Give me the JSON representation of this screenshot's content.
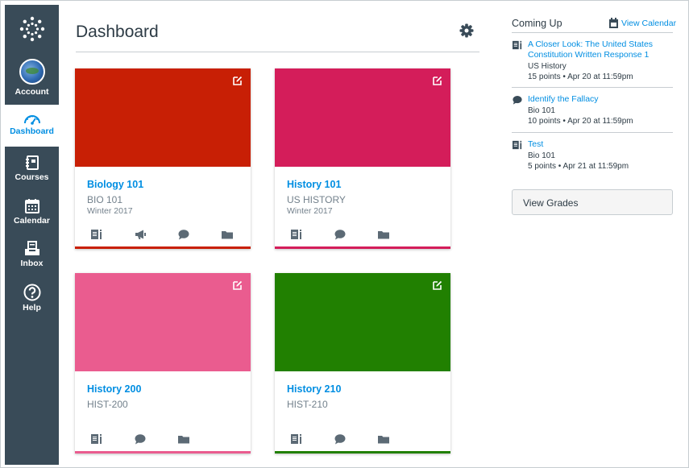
{
  "nav": {
    "account": "Account",
    "dashboard": "Dashboard",
    "courses": "Courses",
    "calendar": "Calendar",
    "inbox": "Inbox",
    "help": "Help"
  },
  "header": {
    "title": "Dashboard"
  },
  "cards": [
    {
      "name": "Biology 101",
      "code": "BIO 101",
      "term": "Winter 2017",
      "color": "#c81f05",
      "icons": [
        "assignments-icon",
        "announcements-icon",
        "discussions-icon",
        "files-icon"
      ]
    },
    {
      "name": "History 101",
      "code": "US HISTORY",
      "term": "Winter 2017",
      "color": "#d41d5a",
      "icons": [
        "assignments-icon",
        "discussions-icon",
        "files-icon"
      ]
    },
    {
      "name": "History 200",
      "code": "HIST-200",
      "term": "",
      "color": "#ea5c8f",
      "icons": [
        "assignments-icon",
        "discussions-icon",
        "files-icon"
      ]
    },
    {
      "name": "History 210",
      "code": "HIST-210",
      "term": "",
      "color": "#218001",
      "icons": [
        "assignments-icon",
        "discussions-icon",
        "files-icon"
      ]
    }
  ],
  "sidebar": {
    "coming_up": "Coming Up",
    "view_calendar": "View Calendar",
    "items": [
      {
        "icon": "assignment-icon",
        "title": "A Closer Look: The United States Constitution Written Response 1",
        "course": "US History",
        "meta": "15 points • Apr 20 at 11:59pm"
      },
      {
        "icon": "discussion-icon",
        "title": "Identify the Fallacy",
        "course": "Bio 101",
        "meta": "10 points • Apr 20 at 11:59pm"
      },
      {
        "icon": "assignment-icon",
        "title": "Test",
        "course": "Bio 101",
        "meta": "5 points • Apr 21 at 11:59pm"
      }
    ],
    "view_grades": "View Grades"
  },
  "colors": {
    "nav_bg": "#394b58",
    "link": "#008ee2",
    "text": "#2d3b45"
  }
}
